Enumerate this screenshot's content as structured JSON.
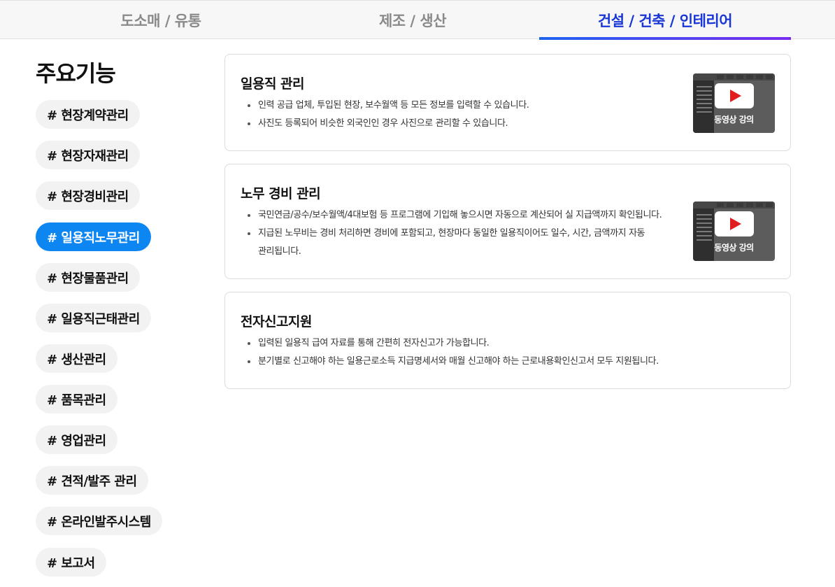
{
  "tabs": [
    {
      "label": "도소매 / 유통",
      "active": false
    },
    {
      "label": "제조 / 생산",
      "active": false
    },
    {
      "label": "건설 / 건축 / 인테리어",
      "active": true
    }
  ],
  "sidebar": {
    "title": "주요기능",
    "items": [
      {
        "label": "# 현장계약관리"
      },
      {
        "label": "# 현장자재관리"
      },
      {
        "label": "# 현장경비관리"
      },
      {
        "label": "# 일용직노무관리",
        "active": true
      },
      {
        "label": "# 현장물품관리"
      },
      {
        "label": "# 일용직근태관리"
      },
      {
        "label": "# 생산관리"
      },
      {
        "label": "# 품목관리"
      },
      {
        "label": "# 영업관리"
      },
      {
        "label": "# 견적/발주 관리"
      },
      {
        "label": "# 온라인발주시스템"
      },
      {
        "label": "# 보고서"
      }
    ]
  },
  "cards": [
    {
      "title": "일용직 관리",
      "bullets": [
        "인력 공급 업체, 투입된 현장, 보수월액 등 모든 정보를 입력할 수 있습니다.",
        "사진도 등록되어 비슷한 외국인인 경우 사진으로 관리할 수 있습니다."
      ],
      "video_label": "동영상 강의"
    },
    {
      "title": "노무 경비 관리",
      "bullets": [
        "국민연금/공수/보수월액/4대보험 등 프로그램에 기입해 놓으시면 자동으로 계산되어 실 지급액까지 확인됩니다.",
        "지급된 노무비는 경비 처리하면 경비에 포함되고, 현장마다 동일한 일용직이어도 일수, 시간, 금액까지 자동",
        "관리됩니다."
      ],
      "video_label": "동영상 강의"
    },
    {
      "title": "전자신고지원",
      "bullets": [
        "입력된 일용직 급여 자료를 통해 간편히 전자신고가 가능합니다.",
        "분기별로 신고해야 하는 일용근로소득 지급명세서와 매월 신고해야 하는 근로내용확인신고서 모두 지원됩니다."
      ]
    }
  ],
  "colors": {
    "active_tab": "#1936d6",
    "active_pill": "#0d86f2",
    "play_icon": "#e21d1d"
  }
}
